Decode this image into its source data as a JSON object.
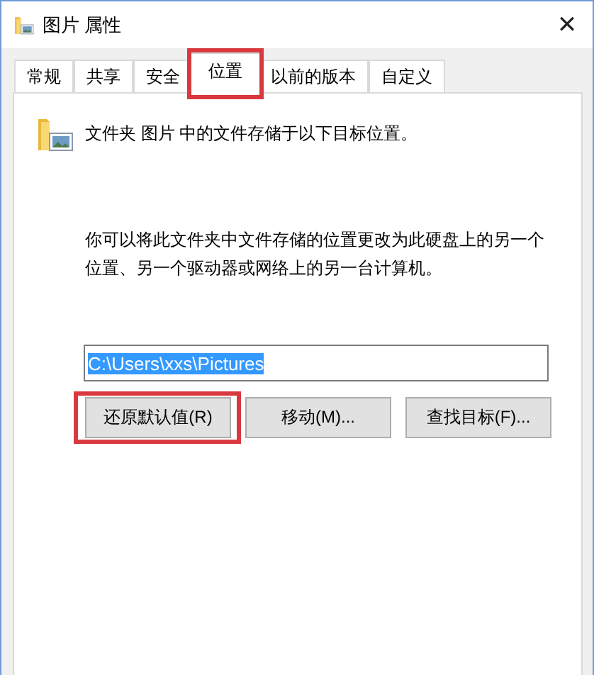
{
  "window": {
    "title": "图片 属性",
    "close": "✕"
  },
  "tabs": [
    {
      "label": "常规",
      "selected": false,
      "highlighted": false
    },
    {
      "label": "共享",
      "selected": false,
      "highlighted": false
    },
    {
      "label": "安全",
      "selected": false,
      "highlighted": false
    },
    {
      "label": "位置",
      "selected": true,
      "highlighted": true
    },
    {
      "label": "以前的版本",
      "selected": false,
      "highlighted": false
    },
    {
      "label": "自定义",
      "selected": false,
      "highlighted": false
    }
  ],
  "header": "文件夹 图片 中的文件存储于以下目标位置。",
  "description": "你可以将此文件夹中文件存储的位置更改为此硬盘上的另一个位置、另一个驱动器或网络上的另一台计算机。",
  "path_field": {
    "value": "C:\\Users\\xxs\\Pictures",
    "text_selected": true
  },
  "buttons": [
    {
      "label": "还原默认值(R)",
      "highlighted": true
    },
    {
      "label": "移动(M)...",
      "highlighted": false
    },
    {
      "label": "查找目标(F)...",
      "highlighted": false
    }
  ]
}
